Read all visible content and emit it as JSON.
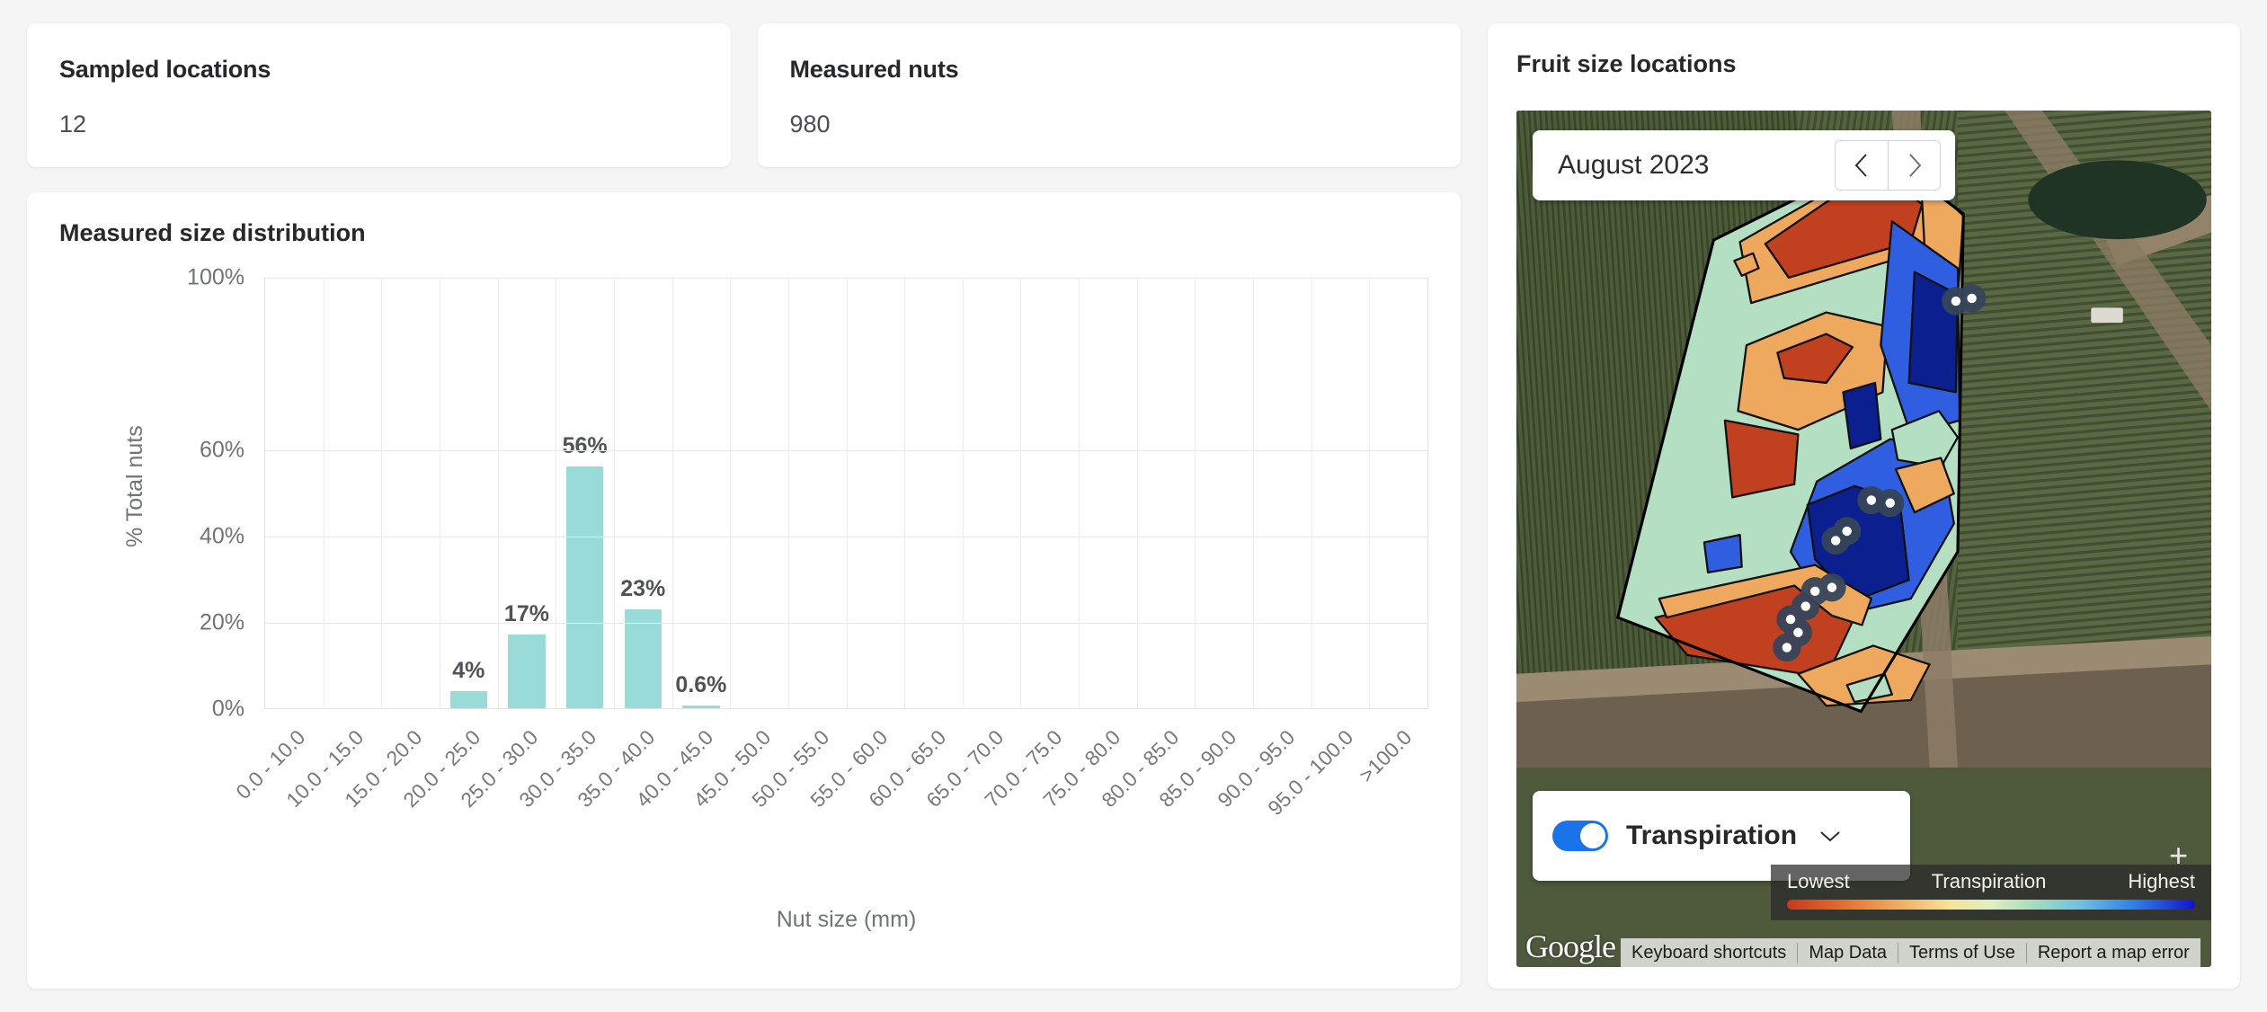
{
  "stats": [
    {
      "title": "Sampled locations",
      "value": "12"
    },
    {
      "title": "Measured nuts",
      "value": "980"
    }
  ],
  "chart_card": {
    "title": "Measured size distribution"
  },
  "chart_data": {
    "type": "bar",
    "title": "Measured size distribution",
    "xlabel": "Nut size (mm)",
    "ylabel": "% Total nuts",
    "ylim": [
      0,
      100
    ],
    "grid": true,
    "ytick_labels": [
      "100%",
      "60%",
      "40%",
      "20%",
      "0%"
    ],
    "ytick_values": [
      100,
      60,
      40,
      20,
      0
    ],
    "categories": [
      "0.0 - 10.0",
      "10.0 - 15.0",
      "15.0 - 20.0",
      "20.0 - 25.0",
      "25.0 - 30.0",
      "30.0 - 35.0",
      "35.0 - 40.0",
      "40.0 - 45.0",
      "45.0 - 50.0",
      "50.0 - 55.0",
      "55.0 - 60.0",
      "60.0 - 65.0",
      "65.0 - 70.0",
      "70.0 - 75.0",
      "75.0 - 80.0",
      "80.0 - 85.0",
      "85.0 - 90.0",
      "90.0 - 95.0",
      "95.0 - 100.0",
      ">100.0"
    ],
    "values": [
      0,
      0,
      0,
      4,
      17,
      56,
      23,
      0.6,
      0,
      0,
      0,
      0,
      0,
      0,
      0,
      0,
      0,
      0,
      0,
      0
    ],
    "value_labels": [
      "",
      "",
      "",
      "4%",
      "17%",
      "56%",
      "23%",
      "0.6%",
      "",
      "",
      "",
      "",
      "",
      "",
      "",
      "",
      "",
      "",
      "",
      ""
    ],
    "bar_color": "#98dbd9"
  },
  "map_card": {
    "title": "Fruit size locations",
    "date": "August 2023",
    "prev_icon": "chevron-left-icon",
    "next_icon": "chevron-right-icon",
    "layer_toggle": {
      "label": "Transpiration",
      "enabled": true,
      "accent": "#1a73e8"
    },
    "legend": {
      "low": "Lowest",
      "title": "Transpiration",
      "high": "Highest"
    },
    "zoom_in": "+",
    "attribution": {
      "logo": "Google",
      "links": [
        "Keyboard shortcuts",
        "Map Data",
        "Terms of Use",
        "Report a map error"
      ]
    }
  }
}
